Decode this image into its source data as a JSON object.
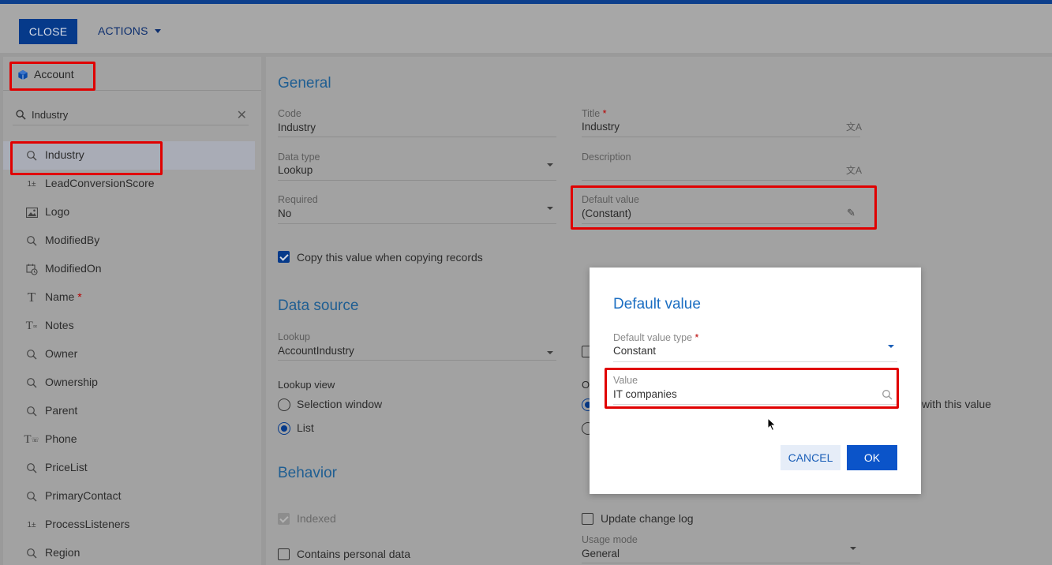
{
  "toolbar": {
    "close_label": "CLOSE",
    "actions_label": "ACTIONS"
  },
  "left": {
    "entity_name": "Account",
    "search": {
      "value": "Industry"
    },
    "items": [
      {
        "label": "Industry",
        "icon": "lookup-search-icon",
        "selected": true
      },
      {
        "label": "LeadConversionScore",
        "icon": "integer-icon"
      },
      {
        "label": "Logo",
        "icon": "image-icon"
      },
      {
        "label": "ModifiedBy",
        "icon": "lookup-search-icon"
      },
      {
        "label": "ModifiedOn",
        "icon": "datetime-icon"
      },
      {
        "label": "Name",
        "icon": "text-icon",
        "required": true
      },
      {
        "label": "Notes",
        "icon": "long-text-icon"
      },
      {
        "label": "Owner",
        "icon": "lookup-search-icon"
      },
      {
        "label": "Ownership",
        "icon": "lookup-search-icon"
      },
      {
        "label": "Parent",
        "icon": "lookup-search-icon"
      },
      {
        "label": "Phone",
        "icon": "phone-text-icon"
      },
      {
        "label": "PriceList",
        "icon": "lookup-search-icon"
      },
      {
        "label": "PrimaryContact",
        "icon": "lookup-search-icon"
      },
      {
        "label": "ProcessListeners",
        "icon": "integer-icon"
      },
      {
        "label": "Region",
        "icon": "lookup-search-icon"
      }
    ]
  },
  "main": {
    "general": {
      "title": "General",
      "code_label": "Code",
      "code_value": "Industry",
      "title_label": "Title",
      "title_value": "Industry",
      "datatype_label": "Data type",
      "datatype_value": "Lookup",
      "description_label": "Description",
      "description_value": "",
      "required_label": "Required",
      "required_value": "No",
      "default_label": "Default value",
      "default_value": "(Constant)",
      "copy_label": "Copy this value when copying records"
    },
    "datasource": {
      "title": "Data source",
      "lookup_label": "Lookup",
      "lookup_value": "AccountIndustry",
      "view_label": "Lookup view",
      "opt_selection": "Selection window",
      "opt_list": "List",
      "partial_right_label": "O",
      "partial_right_text": "with this value"
    },
    "behavior": {
      "title": "Behavior",
      "indexed_label": "Indexed",
      "changelog_label": "Update change log",
      "personal_label": "Contains personal data",
      "usage_label": "Usage mode",
      "usage_value": "General"
    }
  },
  "dialog": {
    "title": "Default value",
    "type_label": "Default value type",
    "type_value": "Constant",
    "value_label": "Value",
    "value_value": "IT companies",
    "cancel_label": "CANCEL",
    "ok_label": "OK"
  },
  "colors": {
    "accent": "#063a8a",
    "highlight": "#e00000",
    "ok_button": "#0b54c9"
  }
}
